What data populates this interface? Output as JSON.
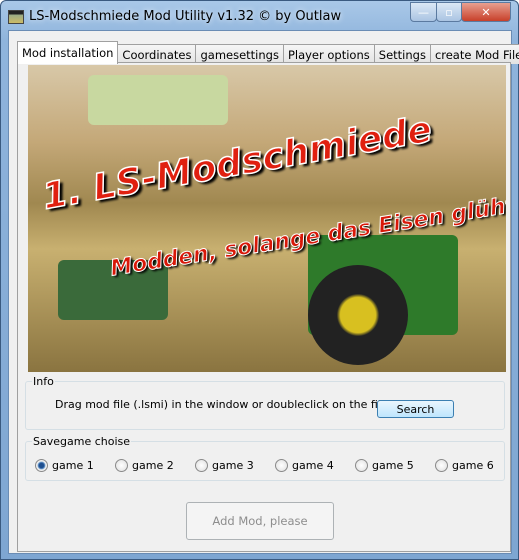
{
  "window": {
    "title": "LS-Modschmiede Mod Utility v1.32 © by Outlaw",
    "minimize": "—",
    "maximize": "▫",
    "close": "✕"
  },
  "tabs": [
    {
      "label": "Mod installation",
      "active": true
    },
    {
      "label": "Coordinates"
    },
    {
      "label": "gamesettings"
    },
    {
      "label": "Player options"
    },
    {
      "label": "Settings"
    },
    {
      "label": "create Mod File"
    }
  ],
  "banner": {
    "line1": "1. LS-Modschmiede",
    "line2": "Modden, solange das Eisen glüht!!"
  },
  "info": {
    "legend": "Info",
    "text": "Drag mod file (.lsmi) in the window or doubleclick on the file",
    "search_label": "Search"
  },
  "savegame": {
    "legend": "Savegame choise",
    "options": [
      "game 1",
      "game 2",
      "game 3",
      "game 4",
      "game 5",
      "game 6"
    ],
    "selected": "game 1"
  },
  "add_button": {
    "label": "Add Mod, please",
    "enabled": false
  }
}
